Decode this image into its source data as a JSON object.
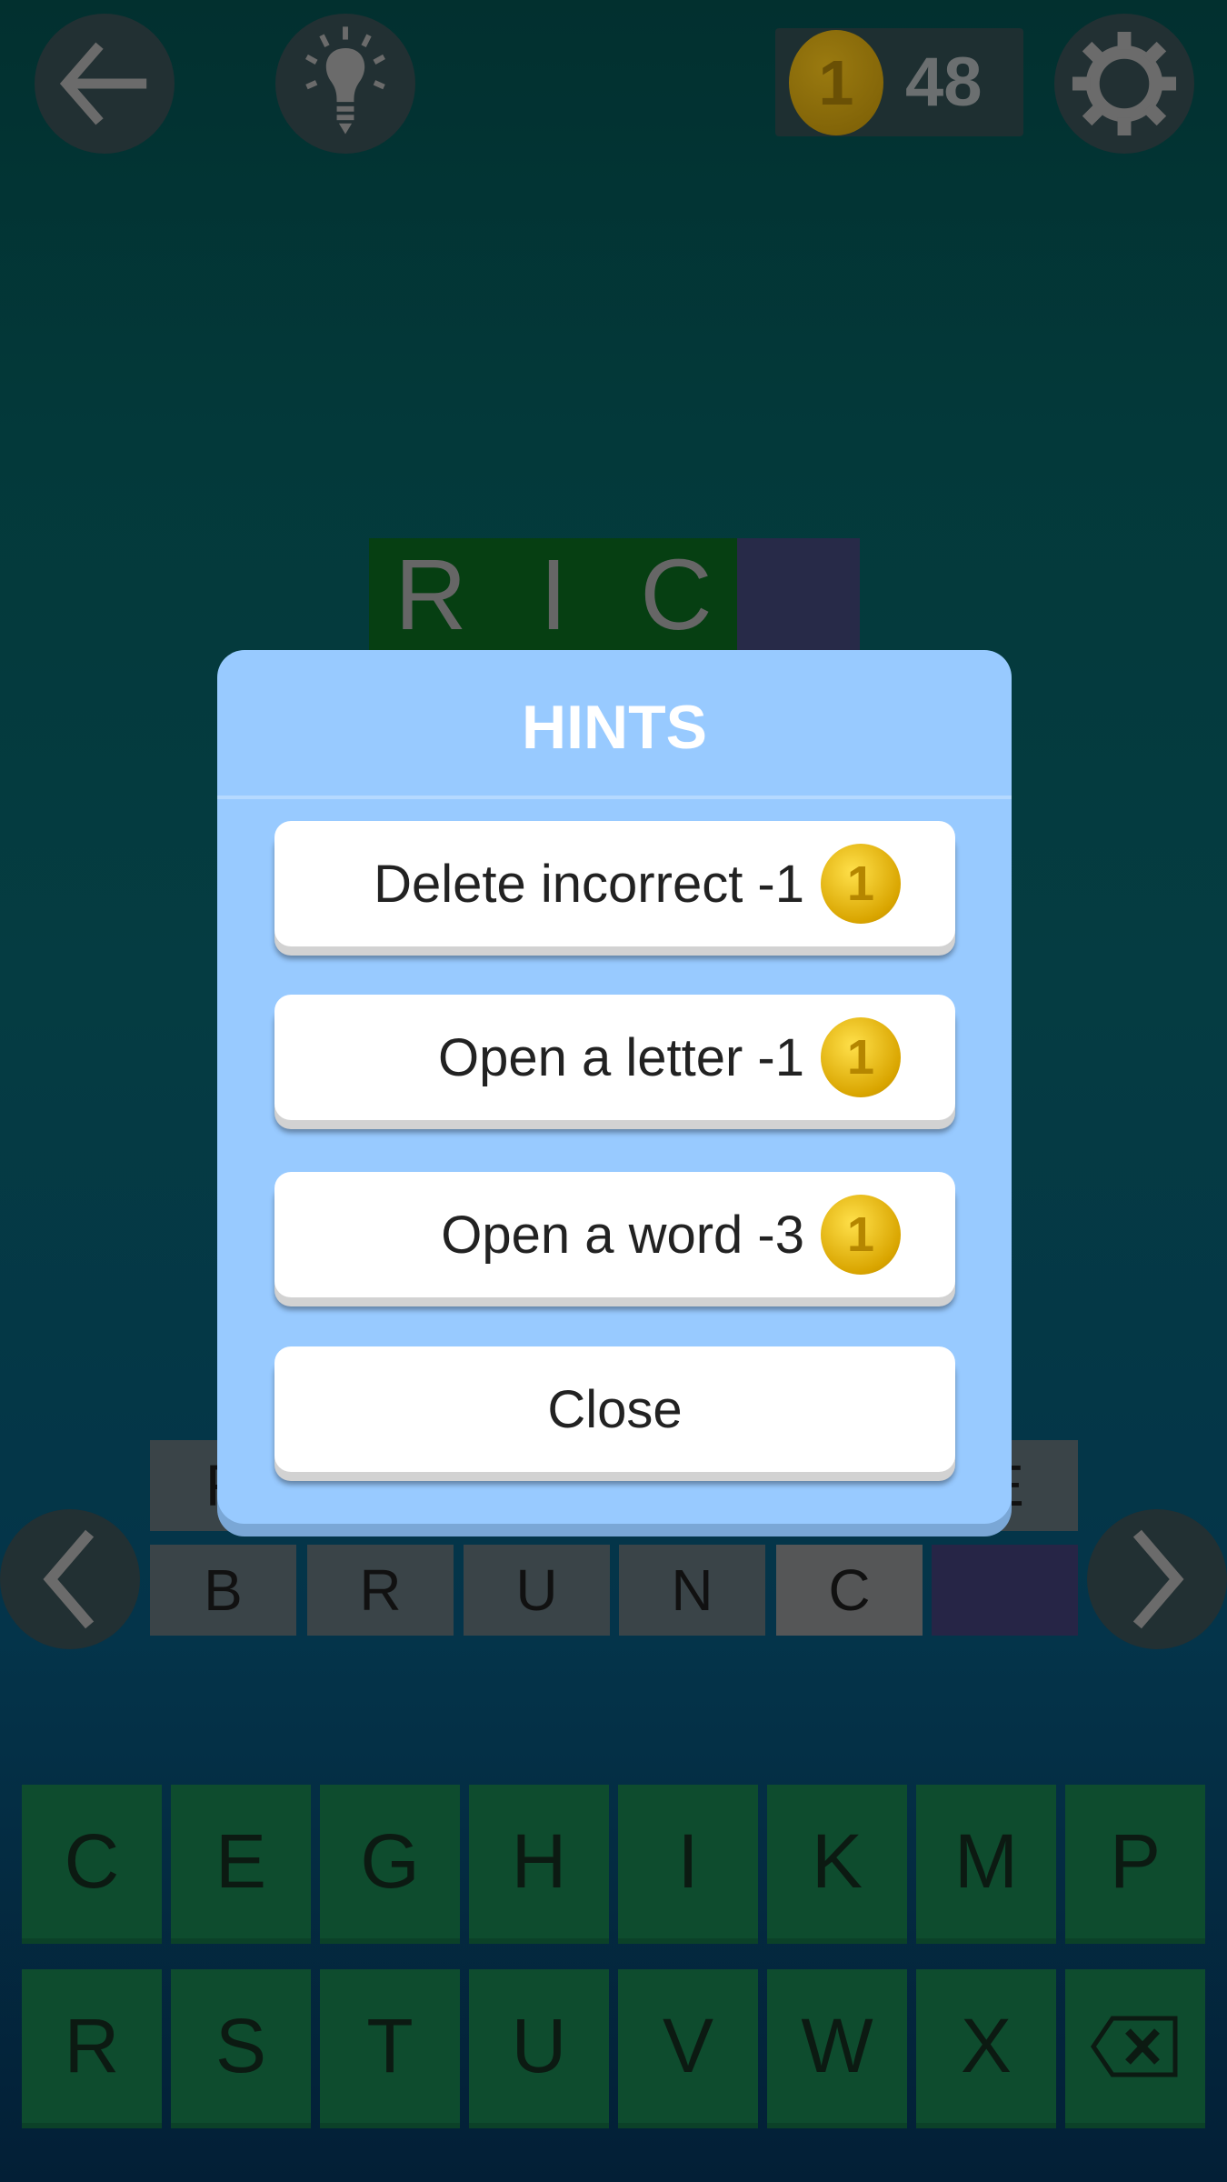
{
  "topbar": {
    "coins": "48",
    "back_icon": "arrow-left-icon",
    "hint_icon": "lightbulb-icon",
    "settings_icon": "gear-icon"
  },
  "word": {
    "letters": [
      "R",
      "I",
      "C",
      ""
    ],
    "colors": {
      "solved": "#063f12",
      "empty": "#272a48"
    }
  },
  "answer_rows": [
    {
      "letters": [
        "F",
        "",
        "",
        "",
        "",
        "E"
      ]
    },
    {
      "letters": [
        "B",
        "R",
        "U",
        "N",
        "C",
        ""
      ]
    }
  ],
  "keyboard": {
    "row1": [
      "C",
      "E",
      "G",
      "H",
      "I",
      "K",
      "M",
      "P"
    ],
    "row2": [
      "R",
      "S",
      "T",
      "U",
      "V",
      "W",
      "X"
    ],
    "backspace_icon": "backspace-icon"
  },
  "dialog": {
    "title": "HINTS",
    "buttons": [
      {
        "label": "Delete incorrect -1",
        "coin": "1"
      },
      {
        "label": "Open a letter -1",
        "coin": "1"
      },
      {
        "label": "Open a word -3",
        "coin": "1"
      }
    ],
    "close": "Close"
  },
  "colors": {
    "dialog": "#98caff",
    "key": "#0e4c2e",
    "coin": "#f2c200"
  }
}
